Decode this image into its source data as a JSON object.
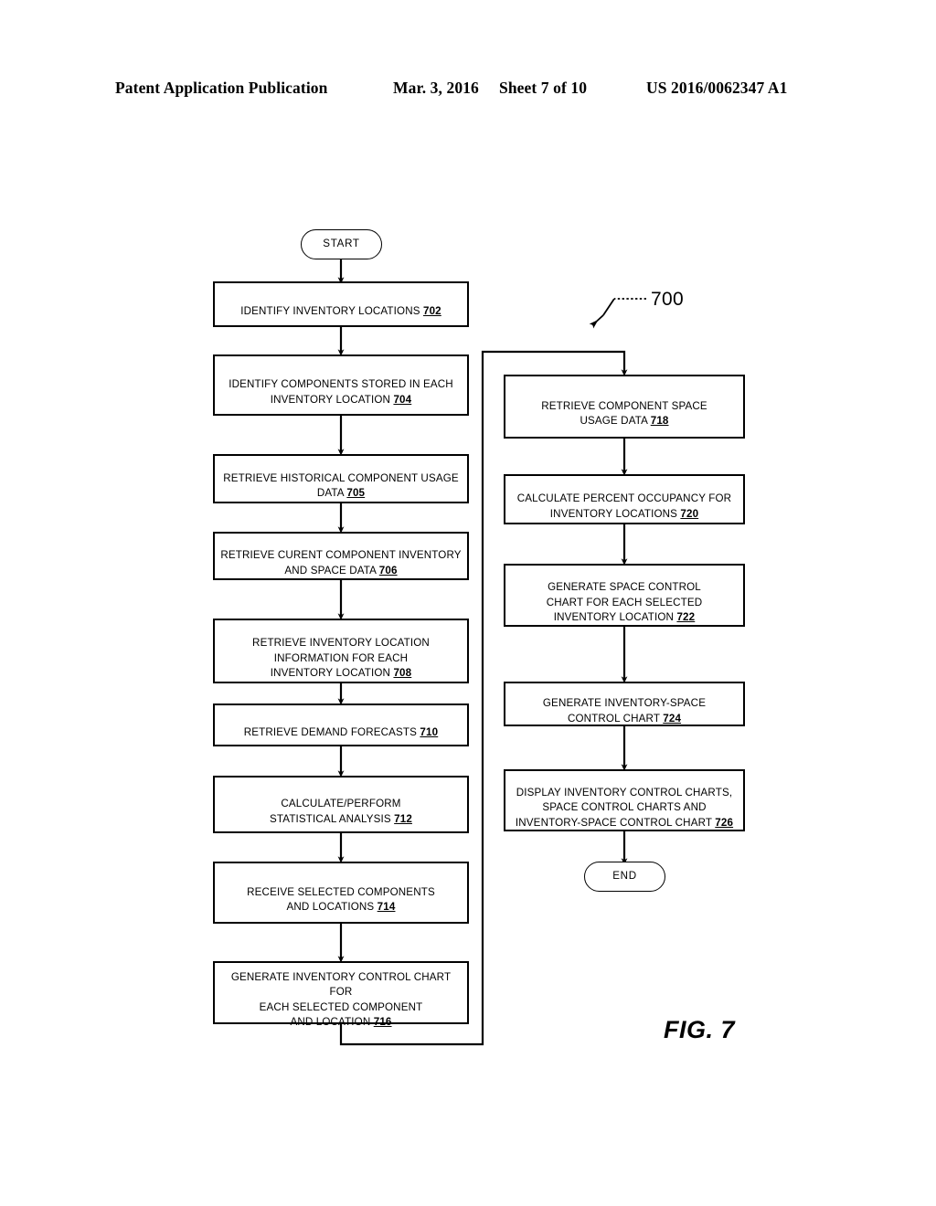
{
  "header": {
    "publication": "Patent Application Publication",
    "date": "Mar. 3, 2016",
    "sheet": "Sheet 7 of 10",
    "patent_number": "US 2016/0062347 A1"
  },
  "figure": {
    "label": "FIG. 7",
    "reference_numeral": "700"
  },
  "flowchart": {
    "start_label": "START",
    "end_label": "END",
    "left_column": [
      {
        "id": "702",
        "text": "IDENTIFY INVENTORY LOCATIONS ",
        "ref": "702"
      },
      {
        "id": "704",
        "text": "IDENTIFY COMPONENTS STORED IN EACH\nINVENTORY LOCATION ",
        "ref": "704"
      },
      {
        "id": "705",
        "text": "RETRIEVE HISTORICAL COMPONENT USAGE\nDATA ",
        "ref": "705"
      },
      {
        "id": "706",
        "text": "RETRIEVE CURENT COMPONENT INVENTORY\nAND SPACE DATA ",
        "ref": "706"
      },
      {
        "id": "708",
        "text": "RETRIEVE INVENTORY LOCATION\nINFORMATION FOR EACH\nINVENTORY LOCATION ",
        "ref": "708"
      },
      {
        "id": "710",
        "text": "RETRIEVE DEMAND FORECASTS ",
        "ref": "710"
      },
      {
        "id": "712",
        "text": "CALCULATE/PERFORM\nSTATISTICAL ANALYSIS ",
        "ref": "712"
      },
      {
        "id": "714",
        "text": "RECEIVE SELECTED COMPONENTS\nAND LOCATIONS  ",
        "ref": "714"
      },
      {
        "id": "716",
        "text": "GENERATE INVENTORY CONTROL CHART FOR\nEACH SELECTED COMPONENT\nAND  LOCATION ",
        "ref": "716"
      }
    ],
    "right_column": [
      {
        "id": "718",
        "text": "RETRIEVE COMPONENT SPACE\nUSAGE DATA ",
        "ref": "718"
      },
      {
        "id": "720",
        "text": "CALCULATE PERCENT OCCUPANCY FOR\nINVENTORY LOCATIONS ",
        "ref": "720"
      },
      {
        "id": "722",
        "text": "GENERATE SPACE CONTROL\nCHART FOR EACH SELECTED\nINVENTORY LOCATION ",
        "ref": "722"
      },
      {
        "id": "724",
        "text": "GENERATE INVENTORY-SPACE\nCONTROL CHART ",
        "ref": "724"
      },
      {
        "id": "726",
        "text": "DISPLAY INVENTORY CONTROL CHARTS,\nSPACE CONTROL CHARTS AND\nINVENTORY-SPACE CONTROL CHART  ",
        "ref": "726"
      }
    ]
  }
}
